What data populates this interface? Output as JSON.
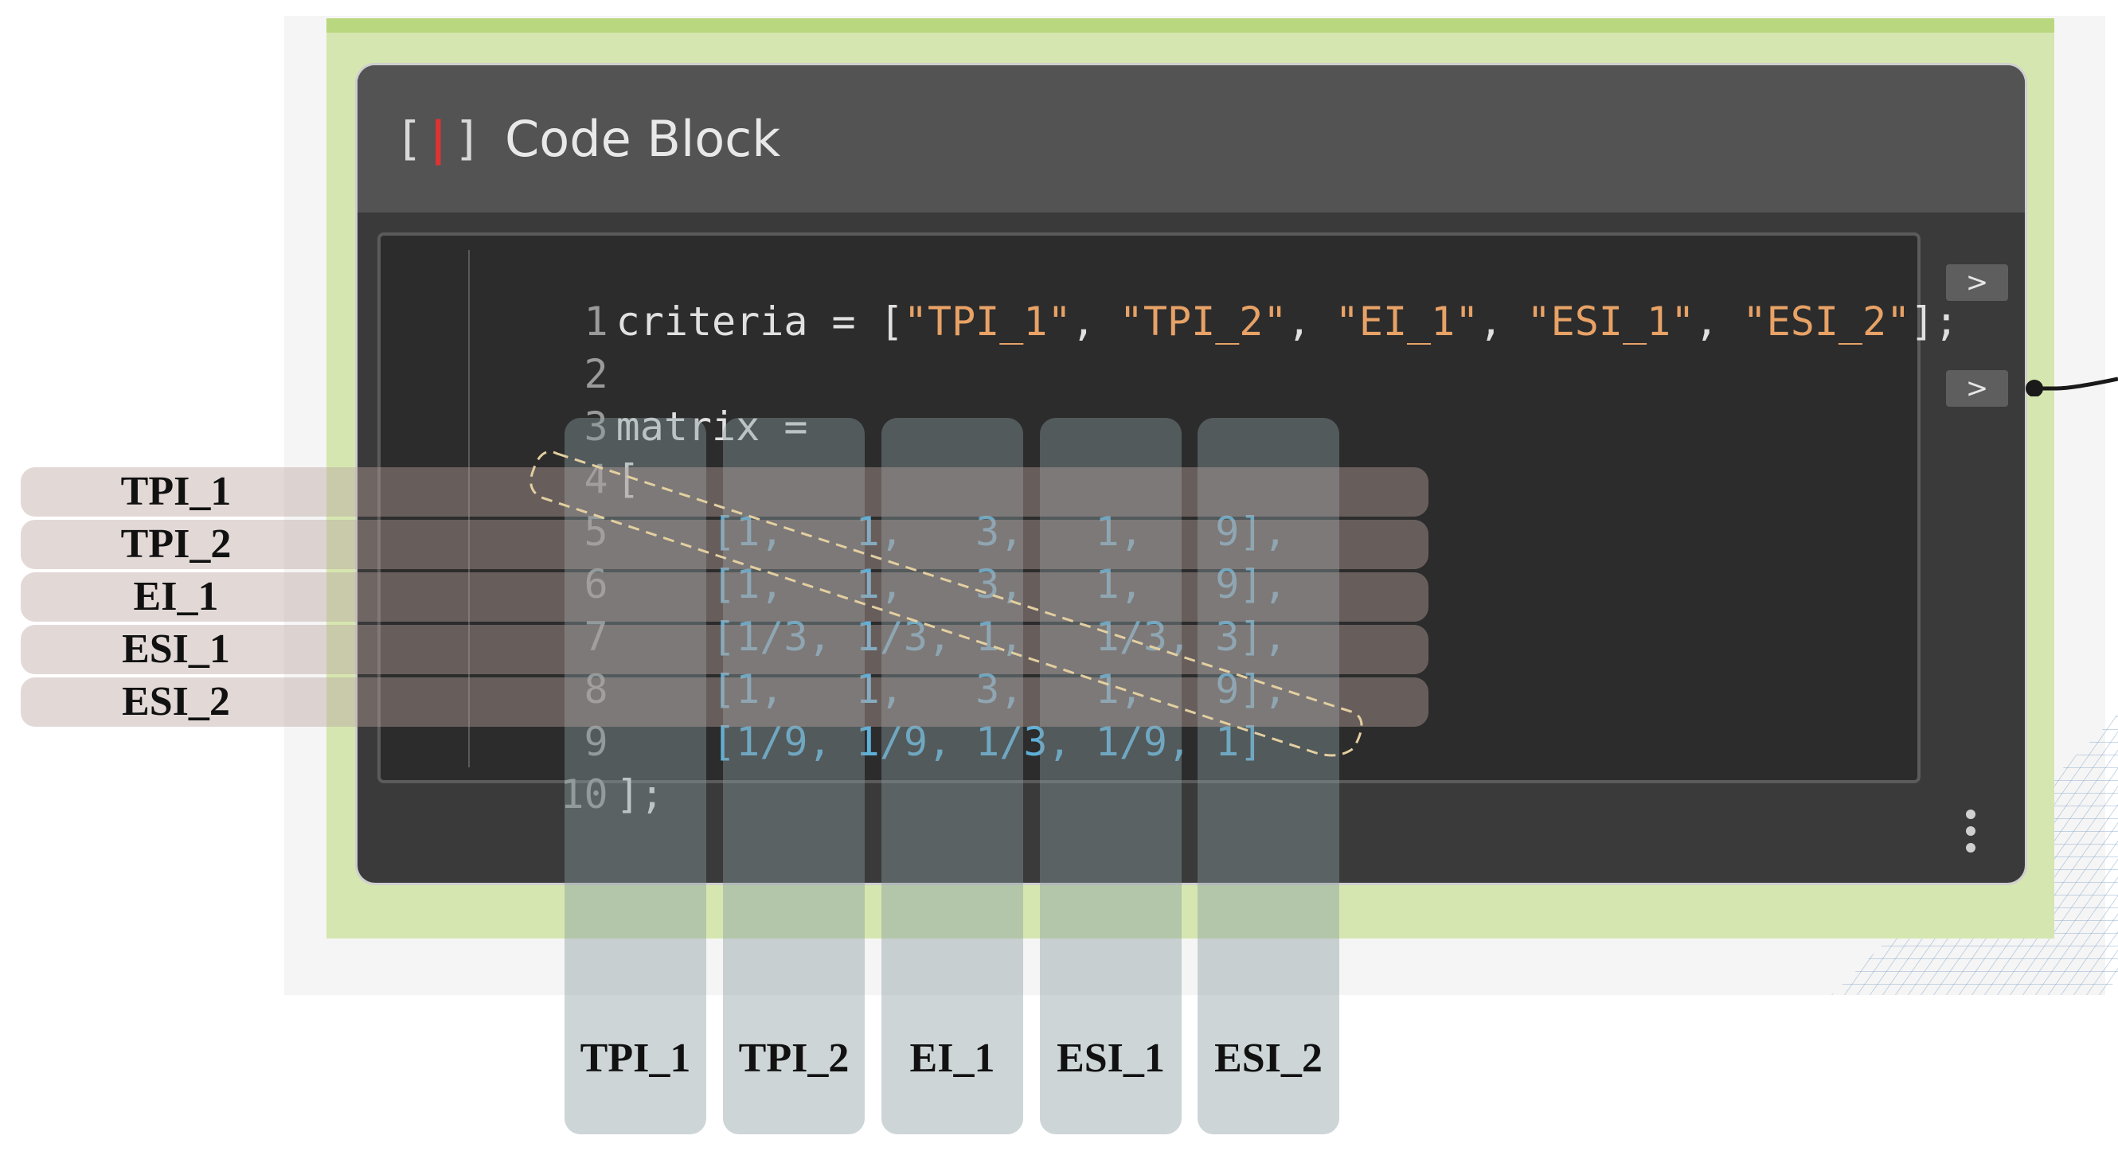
{
  "node": {
    "title": "Code Block",
    "icon": "code-block-icon",
    "code_lines": [
      {
        "ln": "1",
        "text": "criteria = [\"TPI_1\", \"TPI_2\", \"EI_1\", \"ESI_1\", \"ESI_2\"];"
      },
      {
        "ln": "2",
        "text": ""
      },
      {
        "ln": "3",
        "text": "matrix ="
      },
      {
        "ln": "4",
        "text": "["
      },
      {
        "ln": "5",
        "text": "    [1,   1,   3,   1,   9],"
      },
      {
        "ln": "6",
        "text": "    [1,   1,   3,   1,   9],"
      },
      {
        "ln": "7",
        "text": "    [1/3, 1/3, 1,   1/3, 3],"
      },
      {
        "ln": "8",
        "text": "    [1,   1,   3,   1,   9],"
      },
      {
        "ln": "9",
        "text": "    [1/9, 1/9, 1/3, 1/9, 1]"
      },
      {
        "ln": "10",
        "text": "];"
      }
    ],
    "output_ports": [
      ">",
      ">"
    ]
  },
  "overlay": {
    "row_labels": [
      "TPI_1",
      "TPI_2",
      "EI_1",
      "ESI_1",
      "ESI_2"
    ],
    "column_labels": [
      "TPI_1",
      "TPI_2",
      "EI_1",
      "ESI_1",
      "ESI_2"
    ]
  },
  "colors": {
    "node_bg": "#3a3a3a",
    "header_bg": "#535353",
    "selection_halo": "#d5e6b0",
    "string": "#e8a266",
    "number": "#5fb0d8"
  }
}
